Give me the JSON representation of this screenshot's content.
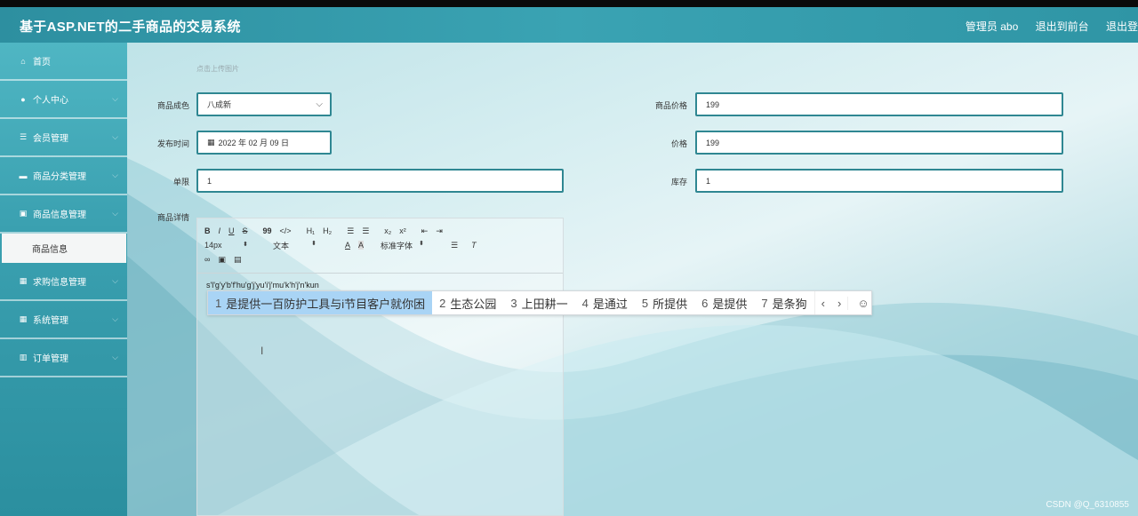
{
  "header": {
    "title": "基于ASP.NET的二手商品的交易系统",
    "admin_label": "管理员 abo",
    "front_link": "退出到前台",
    "logout_link": "退出登"
  },
  "sidebar": {
    "items": [
      {
        "label": "首页",
        "icon": "home-icon"
      },
      {
        "label": "个人中心",
        "icon": "user-icon"
      },
      {
        "label": "会员管理",
        "icon": "sliders-icon"
      },
      {
        "label": "商品分类管理",
        "icon": "chat-icon"
      },
      {
        "label": "商品信息管理",
        "icon": "edit-icon"
      },
      {
        "label": "求购信息管理",
        "icon": "grid-icon"
      },
      {
        "label": "系统管理",
        "icon": "grid-icon"
      },
      {
        "label": "订单管理",
        "icon": "bar-chart-icon"
      }
    ],
    "active_sub": "商品信息"
  },
  "form": {
    "upload_hint": "点击上传图片",
    "condition_label": "商品成色",
    "condition_value": "八成新",
    "price_label": "商品价格",
    "price_value": "199",
    "publish_label": "发布时间",
    "publish_value": "2022 年 02 月 09 日",
    "price2_label": "价格",
    "price2_value": "199",
    "limit_label": "单限",
    "limit_value": "1",
    "stock_label": "库存",
    "stock_value": "1",
    "detail_label": "商品详情"
  },
  "editor": {
    "row1": [
      "B",
      "I",
      "U",
      "S",
      "99",
      "</>",
      "H₁",
      "H₂",
      "☰",
      "☰",
      "x₂",
      "x²",
      "⇤",
      "⇥"
    ],
    "font_size": "14px",
    "text_type": "文本",
    "font_family": "标准字体",
    "content": "s'l'g'y'b'f'hu'g'j'yu'i'j'mu'k'h'j'n'kun"
  },
  "ime": {
    "candidates": [
      {
        "n": "1",
        "text": "是提供一百防护工具与i节目客户就你困"
      },
      {
        "n": "2",
        "text": "生态公园"
      },
      {
        "n": "3",
        "text": "上田耕一"
      },
      {
        "n": "4",
        "text": "是通过"
      },
      {
        "n": "5",
        "text": "所提供"
      },
      {
        "n": "6",
        "text": "是提供"
      },
      {
        "n": "7",
        "text": "是条狗"
      }
    ]
  },
  "watermark": "CSDN @Q_6310855"
}
